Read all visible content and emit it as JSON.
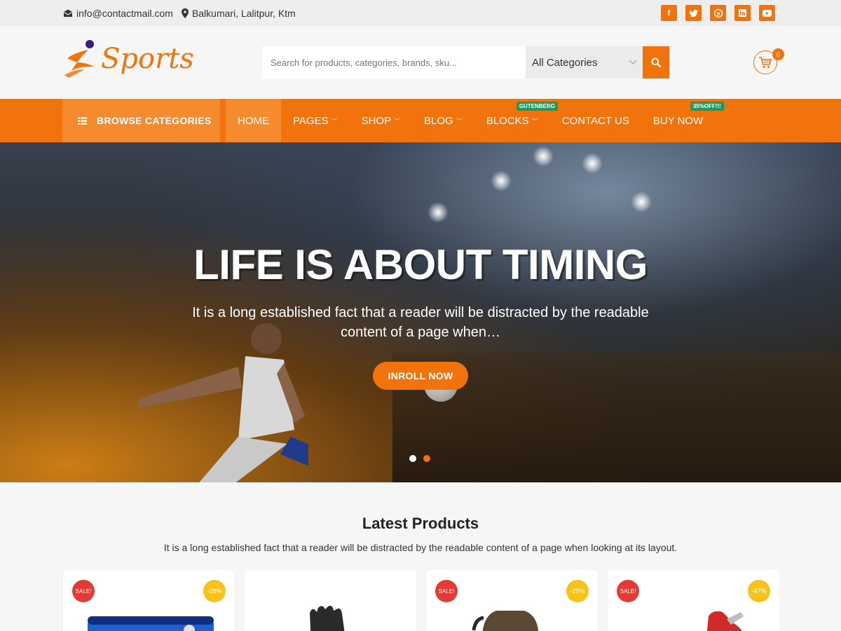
{
  "topbar": {
    "email": "info@contactmail.com",
    "address": "Balkumari, Lalitpur, Ktm",
    "socials": [
      "facebook-icon",
      "twitter-icon",
      "pinterest-icon",
      "linkedin-icon",
      "youtube-icon"
    ]
  },
  "header": {
    "logo_text": "Sports",
    "search_placeholder": "Search for products, categories, brands, sku...",
    "category_select": "All Categories",
    "cart_count": "0"
  },
  "nav": {
    "browse_label": "BROWSE CATEGORIES",
    "items": [
      {
        "label": "HOME",
        "active": true
      },
      {
        "label": "PAGES"
      },
      {
        "label": "SHOP"
      },
      {
        "label": "BLOG"
      },
      {
        "label": "BLOCKS",
        "tag": "GUTENBERG"
      },
      {
        "label": "CONTACT US"
      },
      {
        "label": "BUY NOW",
        "tag": "35%OFF!!!"
      }
    ]
  },
  "hero": {
    "title": "LIFE IS ABOUT TIMING",
    "text": "It is a long established fact that a reader will be distracted by the readable content of a page when…",
    "button": "INROLL NOW"
  },
  "products": {
    "title": "Latest Products",
    "subtitle": "It is a long established fact that a reader will be distracted by the readable content of a page when looking at its layout.",
    "cards": [
      {
        "sale": "SALE!",
        "discount": "-28%"
      },
      {
        "sale": "",
        "discount": ""
      },
      {
        "sale": "SALE!",
        "discount": "-29%"
      },
      {
        "sale": "SALE!",
        "discount": "-47%"
      }
    ]
  },
  "colors": {
    "accent": "#f2720c",
    "accent_light": "#f58a2f",
    "tag_green": "#1a9c61",
    "sale_red": "#e53935",
    "discount_yellow": "#f7c21a"
  }
}
